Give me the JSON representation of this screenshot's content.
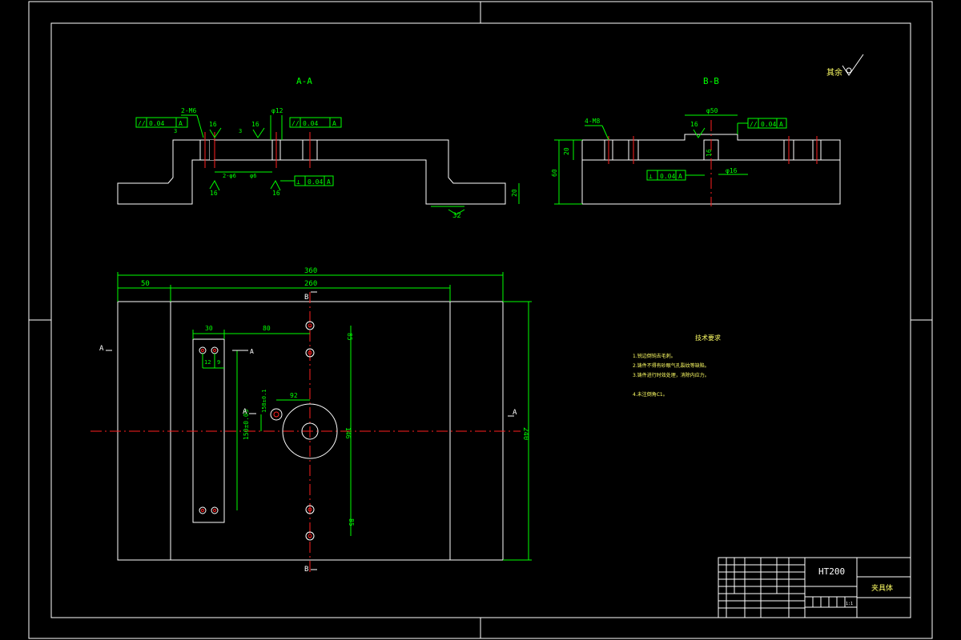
{
  "views": {
    "section_aa_title": "A-A",
    "section_bb_title": "B-B",
    "roughness_symbol": "其余"
  },
  "section_aa": {
    "label_2m6": "2-M6",
    "label_phi12": "φ12",
    "label_16a": "16",
    "label_16b": "16",
    "label_16c": "16",
    "label_16d": "16",
    "label_3a": "3",
    "label_3b": "3",
    "label_holes": "2-φ6",
    "label_phi6": "φ6",
    "label_32": "32",
    "label_20": "20",
    "tol1_sym": "//",
    "tol1_val": "0.04",
    "tol1_ref": "A",
    "tol2_sym": "//",
    "tol2_val": "0.04",
    "tol2_ref": "A",
    "tol3_sym": "⊥",
    "tol3_val": "0.04",
    "tol3_ref": "A"
  },
  "section_bb": {
    "label_4m8": "4-M8",
    "label_phi50": "φ50",
    "label_16a": "16",
    "label_16b": "16",
    "label_phi16": "φ16",
    "label_20": "20",
    "label_60": "60",
    "tol1_sym": "//",
    "tol1_val": "0.04",
    "tol1_ref": "A",
    "tol2_sym": "⊥",
    "tol2_val": "0.04",
    "tol2_ref": "A"
  },
  "plan": {
    "dim_360": "360",
    "dim_50": "50",
    "dim_260": "260",
    "dim_30": "30",
    "dim_80": "80",
    "dim_12": "12",
    "dim_9": "9",
    "dim_92": "92",
    "dim_158": "158±0.1",
    "dim_150": "150±0.05",
    "dim_146": "146",
    "dim_85a": "85",
    "dim_85b": "85",
    "dim_240": "240",
    "label_b_top": "B",
    "label_b_bottom": "B",
    "label_a_left": "A",
    "label_a_right": "A",
    "label_a_mid": "A",
    "label_a_small": "A"
  },
  "notes": {
    "title": "技术要求",
    "items": [
      "1.锐边倒钝去毛刺。",
      "2.铸件不得有砂眼气孔裂纹等缺陷。",
      "3.铸件进行时效处理，消除内应力。",
      "4.未注倒角C1。"
    ]
  },
  "title_block": {
    "material": "HT200",
    "part_name": "夹具体",
    "scale_cell": "1:1"
  }
}
